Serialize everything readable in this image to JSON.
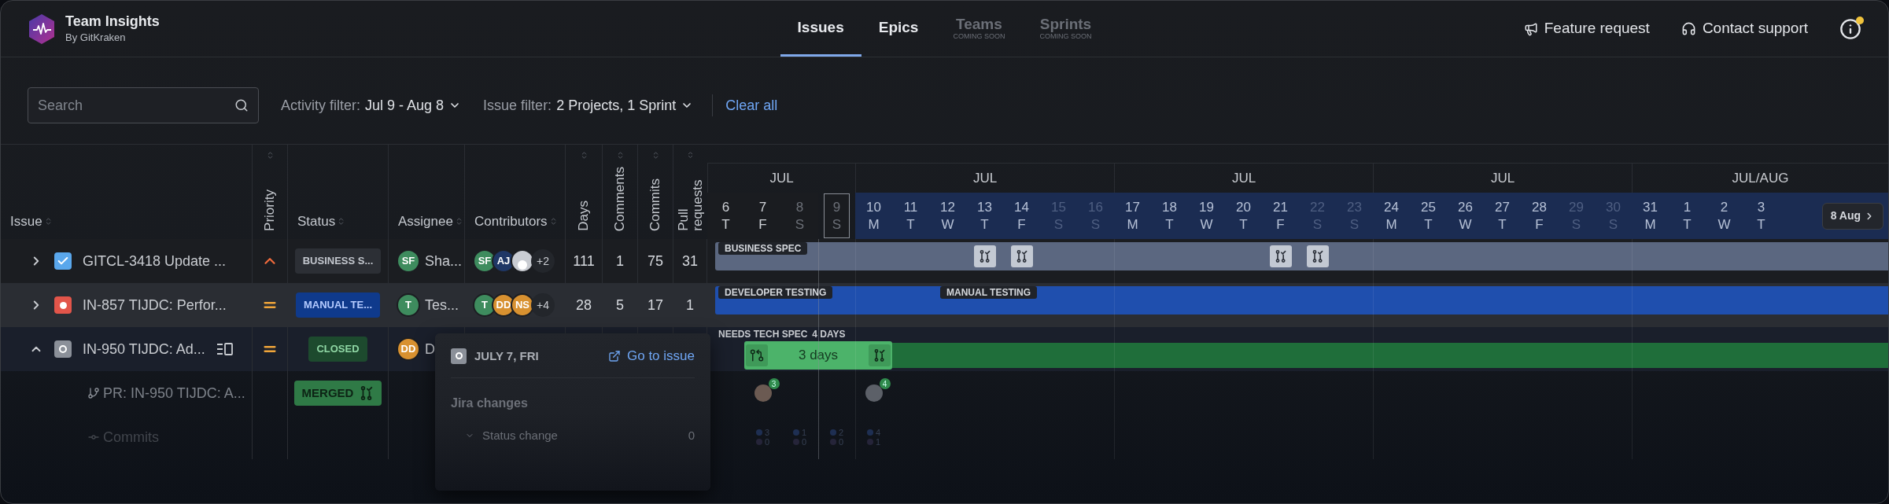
{
  "app": {
    "title": "Team Insights",
    "subtitle": "By GitKraken"
  },
  "nav_tabs": [
    {
      "label": "Issues",
      "selected": true,
      "disabled": false
    },
    {
      "label": "Epics",
      "selected": false,
      "disabled": false
    },
    {
      "label": "Teams",
      "note": "COMING SOON",
      "selected": false,
      "disabled": true
    },
    {
      "label": "Sprints",
      "note": "COMING SOON",
      "selected": false,
      "disabled": true
    }
  ],
  "header_links": [
    {
      "kind": "feature",
      "label": "Feature request"
    },
    {
      "kind": "support",
      "label": "Contact support"
    }
  ],
  "info": {
    "notification": true
  },
  "filters": {
    "search": {
      "placeholder": "Search"
    },
    "activity": {
      "label": "Activity filter:",
      "value": "Jul 9 - Aug 8"
    },
    "issue": {
      "label": "Issue filter:",
      "value": "2 Projects, 1 Sprint"
    },
    "clear": "Clear all"
  },
  "columns": [
    {
      "label": "Issue",
      "kind": "horizontal"
    },
    {
      "label": "Priority",
      "kind": "vertical"
    },
    {
      "label": "Status",
      "kind": "horizontal"
    },
    {
      "label": "Assignee",
      "kind": "horizontal"
    },
    {
      "label": "Contributors",
      "kind": "horizontal"
    },
    {
      "label": "Days",
      "kind": "vertical"
    },
    {
      "label": "Comments",
      "kind": "vertical"
    },
    {
      "label": "Commits",
      "kind": "vertical"
    },
    {
      "label": "Pull requests",
      "kind": "vertical"
    }
  ],
  "rows": [
    {
      "expanded": false,
      "selected": false,
      "kind": "story",
      "title": "GITCL-3418 Update ...",
      "details_icon": false,
      "priority": {
        "kind": "high"
      },
      "status": {
        "label": "BUSINESS S...",
        "kind": "neutral"
      },
      "assignee": {
        "initials": "SF",
        "color": "#3e8c5e",
        "name": "Sha..."
      },
      "contributors": [
        {
          "kind": "initials",
          "initials": "SF",
          "color": "#3e8c5e"
        },
        {
          "kind": "initials",
          "initials": "AJ",
          "color": "#1f3766"
        },
        {
          "kind": "photo",
          "color": "#c9ccd2"
        }
      ],
      "more": "+2",
      "days": "111",
      "comments": "1",
      "commits": "75",
      "pull_requests": "31"
    },
    {
      "expanded": false,
      "selected": true,
      "kind": "bug",
      "title": "IN-857 TIJDC: Perfor...",
      "details_icon": false,
      "priority": {
        "kind": "medium"
      },
      "status": {
        "label": "MANUAL TE...",
        "kind": "progress"
      },
      "assignee": {
        "initials": "T",
        "color": "#3e8c5e",
        "name": "Tes..."
      },
      "contributors": [
        {
          "kind": "initials",
          "initials": "T",
          "color": "#3e8c5e"
        },
        {
          "kind": "initials",
          "initials": "DD",
          "color": "#d89130"
        },
        {
          "kind": "initials",
          "initials": "NS",
          "color": "#d89130"
        }
      ],
      "more": "+4",
      "days": "28",
      "comments": "5",
      "commits": "17",
      "pull_requests": "1"
    },
    {
      "expanded": true,
      "selected": false,
      "kind": "task",
      "title": "IN-950 TIJDC: Ad...",
      "details_icon": true,
      "priority": {
        "kind": "medium"
      },
      "status": {
        "label": "CLOSED",
        "kind": "done"
      },
      "assignee": {
        "initials": "DD",
        "color": "#d89130",
        "name": "D"
      },
      "children": [
        {
          "kind": "pr",
          "title": "PR: IN-950 TIJDC: A...",
          "status": {
            "label": "MERGED",
            "kind": "merged"
          }
        },
        {
          "kind": "commits",
          "title": "Commits"
        }
      ]
    }
  ],
  "timeline": {
    "jump": "8 Aug",
    "weeks": [
      {
        "label": "JUL",
        "days": [
          {
            "date": "6",
            "weekday": "T",
            "weekend": false,
            "in_range": false,
            "today": false
          },
          {
            "date": "7",
            "weekday": "F",
            "weekend": false,
            "in_range": false,
            "today": false
          },
          {
            "date": "8",
            "weekday": "S",
            "weekend": true,
            "in_range": false,
            "today": false
          },
          {
            "date": "9",
            "weekday": "S",
            "weekend": true,
            "in_range": false,
            "today": true
          }
        ]
      },
      {
        "label": "JUL",
        "days": [
          {
            "date": "10",
            "weekday": "M",
            "weekend": false,
            "in_range": true,
            "today": false
          },
          {
            "date": "11",
            "weekday": "T",
            "weekend": false,
            "in_range": true,
            "today": false
          },
          {
            "date": "12",
            "weekday": "W",
            "weekend": false,
            "in_range": true,
            "today": false
          },
          {
            "date": "13",
            "weekday": "T",
            "weekend": false,
            "in_range": true,
            "today": false
          },
          {
            "date": "14",
            "weekday": "F",
            "weekend": false,
            "in_range": true,
            "today": false
          },
          {
            "date": "15",
            "weekday": "S",
            "weekend": true,
            "in_range": true,
            "today": false
          },
          {
            "date": "16",
            "weekday": "S",
            "weekend": true,
            "in_range": true,
            "today": false
          }
        ]
      },
      {
        "label": "JUL",
        "days": [
          {
            "date": "17",
            "weekday": "M",
            "weekend": false,
            "in_range": true,
            "today": false
          },
          {
            "date": "18",
            "weekday": "T",
            "weekend": false,
            "in_range": true,
            "today": false
          },
          {
            "date": "19",
            "weekday": "W",
            "weekend": false,
            "in_range": true,
            "today": false
          },
          {
            "date": "20",
            "weekday": "T",
            "weekend": false,
            "in_range": true,
            "today": false
          },
          {
            "date": "21",
            "weekday": "F",
            "weekend": false,
            "in_range": true,
            "today": false
          },
          {
            "date": "22",
            "weekday": "S",
            "weekend": true,
            "in_range": true,
            "today": false
          },
          {
            "date": "23",
            "weekday": "S",
            "weekend": true,
            "in_range": true,
            "today": false
          }
        ]
      },
      {
        "label": "JUL",
        "days": [
          {
            "date": "24",
            "weekday": "M",
            "weekend": false,
            "in_range": true,
            "today": false
          },
          {
            "date": "25",
            "weekday": "T",
            "weekend": false,
            "in_range": true,
            "today": false
          },
          {
            "date": "26",
            "weekday": "W",
            "weekend": false,
            "in_range": true,
            "today": false
          },
          {
            "date": "27",
            "weekday": "T",
            "weekend": false,
            "in_range": true,
            "today": false
          },
          {
            "date": "28",
            "weekday": "F",
            "weekend": false,
            "in_range": true,
            "today": false
          },
          {
            "date": "29",
            "weekday": "S",
            "weekend": true,
            "in_range": true,
            "today": false
          },
          {
            "date": "30",
            "weekday": "S",
            "weekend": true,
            "in_range": true,
            "today": false
          }
        ]
      },
      {
        "label": "JUL/AUG",
        "days": [
          {
            "date": "31",
            "weekday": "M",
            "weekend": false,
            "in_range": true,
            "today": false
          },
          {
            "date": "1",
            "weekday": "T",
            "weekend": false,
            "in_range": true,
            "today": false
          },
          {
            "date": "2",
            "weekday": "W",
            "weekend": false,
            "in_range": true,
            "today": false
          },
          {
            "date": "3",
            "weekday": "T",
            "weekend": false,
            "in_range": true,
            "today": false
          }
        ]
      }
    ],
    "lanes": [
      {
        "kind": "bar",
        "color": "#5b6780",
        "labels": [
          "BUSINESS SPEC"
        ],
        "markers": [
          {
            "kind": "merged"
          },
          {
            "kind": "merged"
          },
          {
            "kind": "merged"
          },
          {
            "kind": "merged"
          }
        ]
      },
      {
        "kind": "bar",
        "color": "#1f4fae",
        "labels": [
          "DEVELOPER TESTING",
          "MANUAL TESTING"
        ]
      },
      {
        "kind": "progress",
        "caption": "NEEDS TECH SPEC",
        "duration": "4 DAYS",
        "segment": "3 days",
        "markers": [
          {
            "kind": "opened"
          },
          {
            "kind": "merged"
          }
        ]
      },
      {
        "kind": "avatars",
        "items": [
          {
            "kind": "photo",
            "count": "3"
          },
          {
            "kind": "silhouette",
            "count": "4"
          }
        ]
      },
      {
        "kind": "commits",
        "items": [
          {
            "counts": [
              "3",
              "0"
            ]
          },
          {
            "counts": [
              "1",
              "0"
            ]
          },
          {
            "counts": [
              "2",
              "0"
            ]
          },
          {
            "counts": [
              "4",
              "1"
            ]
          }
        ]
      }
    ]
  },
  "popover": {
    "date": "JULY 7, FRI",
    "link": "Go to issue",
    "section": "Jira changes",
    "entries": [
      {
        "label": "Status change",
        "count": "0",
        "expanded": false
      }
    ]
  }
}
